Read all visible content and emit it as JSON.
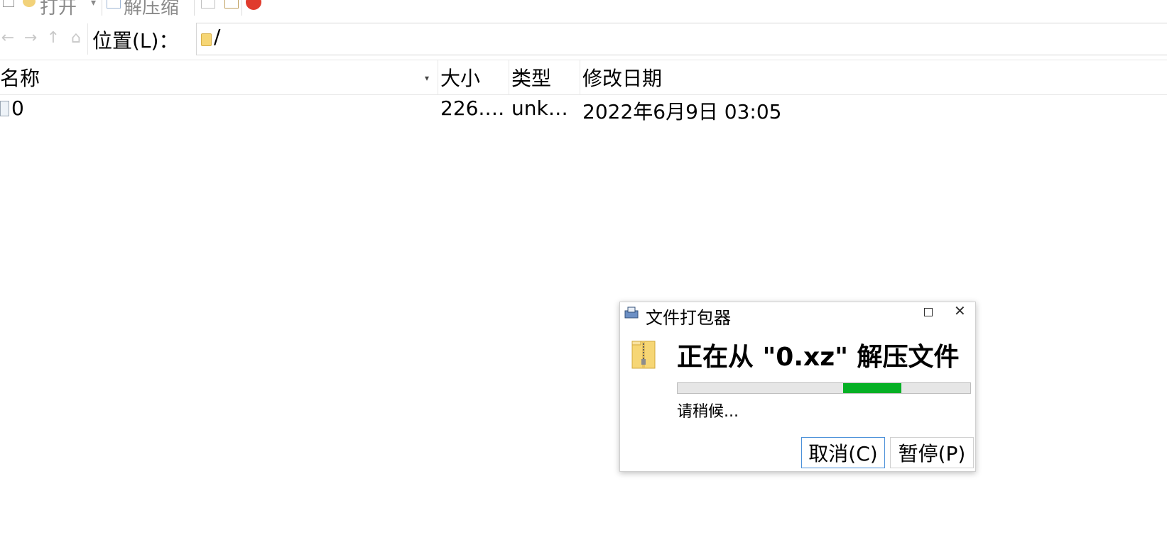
{
  "toolbar": {
    "open_label": "打开",
    "open_dropdown": "▾",
    "extract_label": "解压缩"
  },
  "nav": {
    "back": "←",
    "forward": "→",
    "up": "↑",
    "home": "⌂",
    "location_label": "位置(L)：",
    "location_path": "/"
  },
  "columns": {
    "name": "名称",
    "size": "大小",
    "type": "类型",
    "modified": "修改日期"
  },
  "files": [
    {
      "name": "0",
      "size": "226.…",
      "type": "unk…",
      "modified": "2022年6月9日 03:05"
    }
  ],
  "dialog": {
    "title": "文件打包器",
    "maximize": "□",
    "close": "✕",
    "heading": "正在从 \"0.xz\" 解压文件",
    "status": "请稍候...",
    "progress": {
      "start_fraction": 0.565,
      "end_fraction": 0.765
    },
    "cancel_label": "取消(C)",
    "pause_label": "暂停(P)"
  },
  "colors": {
    "progress_fill": "#06b025",
    "folder": "#f6d675",
    "close_red": "#e03b2d"
  }
}
